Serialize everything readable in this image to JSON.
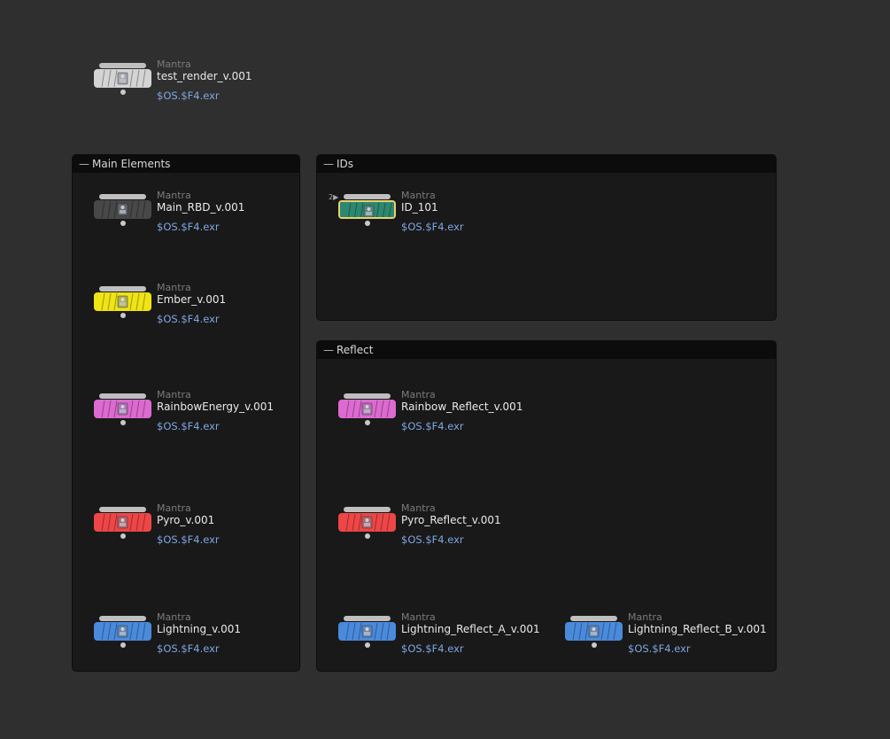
{
  "network": {
    "boxes": [
      {
        "title": "Main Elements"
      },
      {
        "title": "IDs"
      },
      {
        "title": "Reflect"
      }
    ],
    "nodes": [
      {
        "type": "Mantra",
        "name": "test_render_v.001",
        "output": "$OS.$F4.exr",
        "color": "#d4d4d4",
        "selected": false
      },
      {
        "type": "Mantra",
        "name": "Main_RBD_v.001",
        "output": "$OS.$F4.exr",
        "color": "#484848",
        "selected": false
      },
      {
        "type": "Mantra",
        "name": "Ember_v.001",
        "output": "$OS.$F4.exr",
        "color": "#f0e414",
        "selected": false
      },
      {
        "type": "Mantra",
        "name": "RainbowEnergy_v.001",
        "output": "$OS.$F4.exr",
        "color": "#dd6ad0",
        "selected": false
      },
      {
        "type": "Mantra",
        "name": "Pyro_v.001",
        "output": "$OS.$F4.exr",
        "color": "#ee4646",
        "selected": false
      },
      {
        "type": "Mantra",
        "name": "Lightning_v.001",
        "output": "$OS.$F4.exr",
        "color": "#4a8adc",
        "selected": false
      },
      {
        "type": "Mantra",
        "name": "ID_101",
        "output": "$OS.$F4.exr",
        "color": "#2d8870",
        "selected": true,
        "badge": "2"
      },
      {
        "type": "Mantra",
        "name": "Rainbow_Reflect_v.001",
        "output": "$OS.$F4.exr",
        "color": "#dd6ad0",
        "selected": false
      },
      {
        "type": "Mantra",
        "name": "Pyro_Reflect_v.001",
        "output": "$OS.$F4.exr",
        "color": "#ee4646",
        "selected": false
      },
      {
        "type": "Mantra",
        "name": "Lightning_Reflect_A_v.001",
        "output": "$OS.$F4.exr",
        "color": "#4a8adc",
        "selected": false
      },
      {
        "type": "Mantra",
        "name": "Lightning_Reflect_B_v.001",
        "output": "$OS.$F4.exr",
        "color": "#4a8adc",
        "selected": false
      }
    ]
  }
}
